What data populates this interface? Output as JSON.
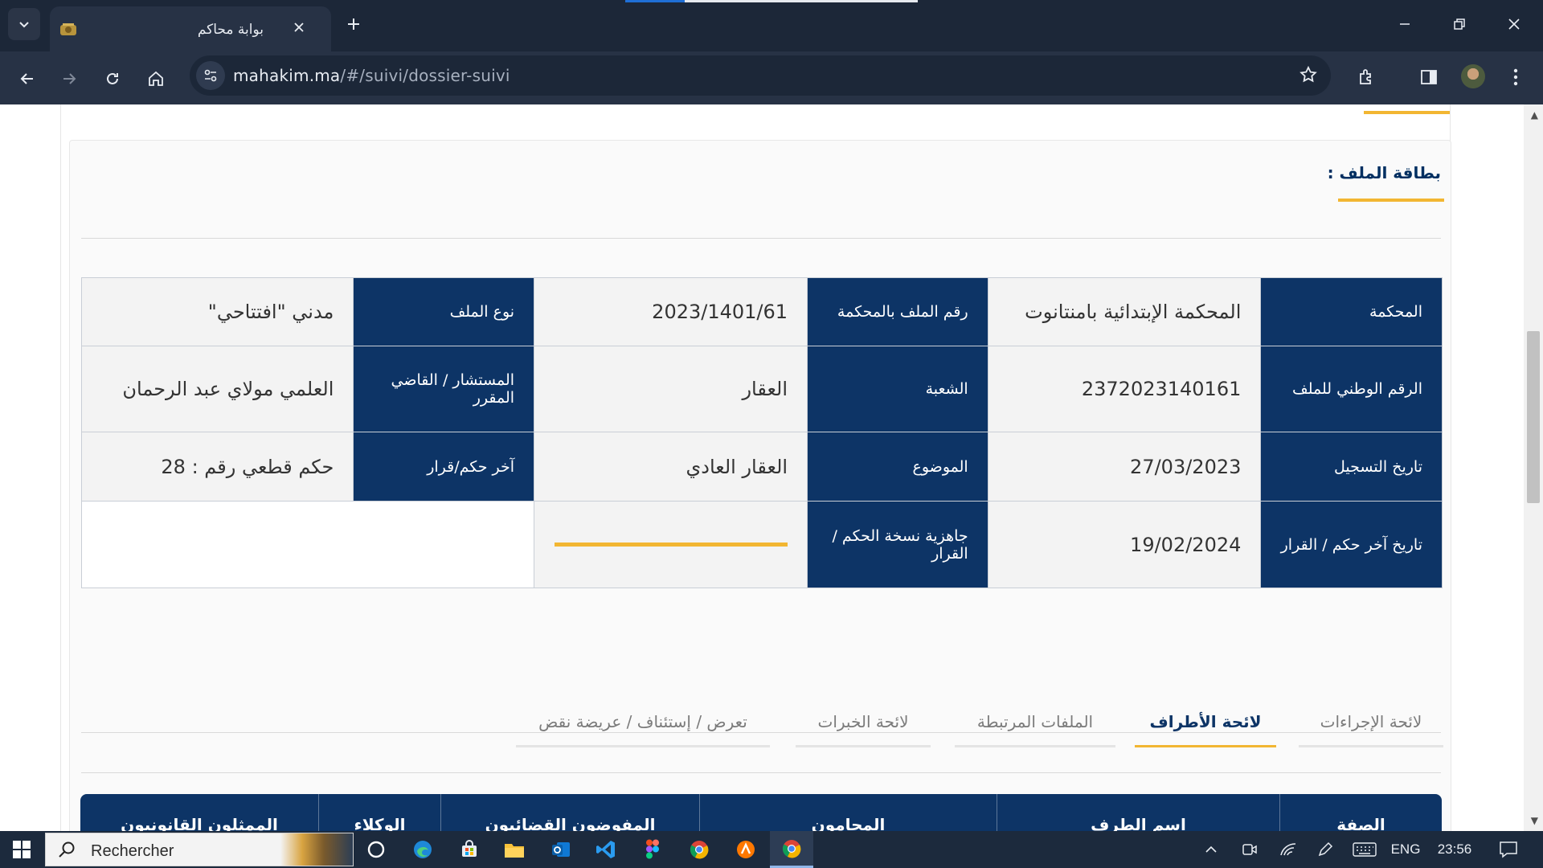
{
  "browser": {
    "tab_title": "بوابة محاكم",
    "url_domain": "mahakim.ma",
    "url_path": "/#/suivi/dossier-suivi"
  },
  "card": {
    "title": "بطاقة الملف :"
  },
  "info_table": {
    "court_label": "المحكمة",
    "court_value": "المحكمة الإبتدائية بامنتانوت",
    "file_number_label": "رقم الملف بالمحكمة",
    "file_number_value": "2023/1401/61",
    "file_type_label": "نوع الملف",
    "file_type_value": "مدني \"افتتاحي\"",
    "national_number_label": "الرقم الوطني للملف",
    "national_number_value": "2372023140161",
    "division_label": "الشعبة",
    "division_value": "العقار",
    "judge_label": "المستشار / القاضي المقرر",
    "judge_value": "العلمي مولاي عبد الرحمان",
    "registration_date_label": "تاريخ التسجيل",
    "registration_date_value": "27/03/2023",
    "subject_label": "الموضوع",
    "subject_value": "العقار العادي",
    "last_judgment_label": "آخر حكم/قرار",
    "last_judgment_value": "حكم قطعي رقم : 28",
    "last_judgment_date_label": "تاريخ آخر حكم / القرار",
    "last_judgment_date_value": "19/02/2024",
    "copy_ready_label": "جاهزية نسخة الحكم / القرار"
  },
  "tabs": [
    {
      "label": "لائحة الإجراءات",
      "active": false
    },
    {
      "label": "لائحة الأطراف",
      "active": true
    },
    {
      "label": "الملفات المرتبطة",
      "active": false
    },
    {
      "label": "لائحة الخبرات",
      "active": false
    },
    {
      "label": "تعرض / إستئناف / عريضة نقض",
      "active": false
    }
  ],
  "parties_table": {
    "headers": [
      "الصفة",
      "اسم الطرف",
      "المحامون",
      "المفوضون القضائيون",
      "الوكلاء",
      "الممثلون القانونيون"
    ]
  },
  "taskbar": {
    "search_placeholder": "Rechercher",
    "language": "ENG",
    "time": "23:56"
  },
  "colors": {
    "primary_navy": "#0d3466",
    "accent_yellow": "#f2b632",
    "browser_dark": "#1c2738"
  }
}
